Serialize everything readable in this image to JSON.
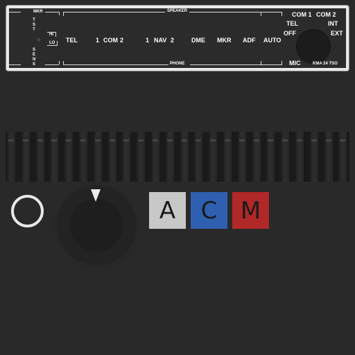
{
  "panel": {
    "mkr": {
      "title": "MKR",
      "tst": "TST",
      "sens": "SENS",
      "hi": "HI",
      "lo": "LO"
    },
    "speaker_label": "SPEAKER",
    "phone_label": "PHONE",
    "buttons": [
      "TEL",
      "1",
      "COM",
      "2",
      "1",
      "NAV",
      "2",
      "DME",
      "MKR",
      "ADF",
      "AUTO"
    ],
    "mic": {
      "com1": "COM 1",
      "com2": "COM 2",
      "tel": "TEL",
      "off": "OFF",
      "int": "INT",
      "ext": "EXT",
      "mic": "MIC"
    },
    "model": "KMA 24 TSO"
  },
  "controls": {
    "button_a": {
      "label": "A",
      "color": "#c8c8c8"
    },
    "button_c": {
      "label": "C",
      "color": "#2f5fb0"
    },
    "button_m": {
      "label": "M",
      "color": "#b02828"
    }
  }
}
